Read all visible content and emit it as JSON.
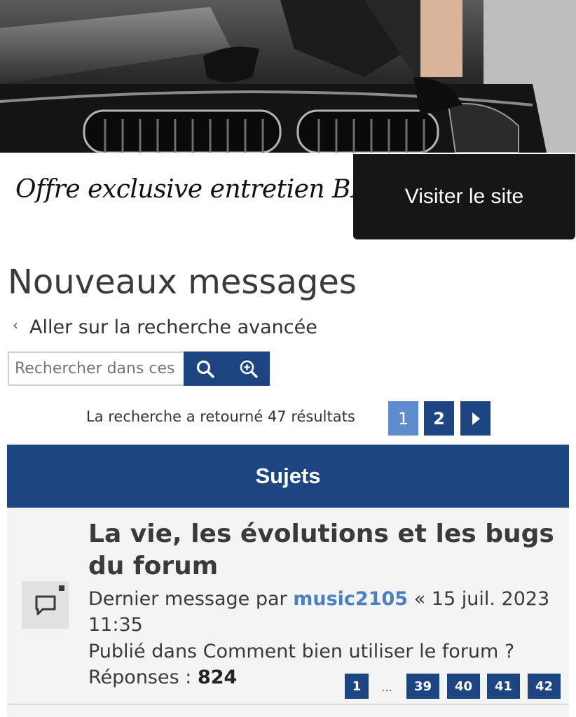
{
  "ad": {
    "banner_alt": "Mécanicien inspectant le moteur d'une BMW",
    "tagline": "Offre exclusive entretien BMW",
    "cta_label": "Visiter le site"
  },
  "page": {
    "title": "Nouveaux messages",
    "back_link": "Aller sur la recherche avancée"
  },
  "search": {
    "placeholder": "Rechercher dans ces résultats…",
    "value": "",
    "search_icon": "search-icon",
    "advanced_icon": "zoom-plus-icon"
  },
  "pagination": {
    "summary": "La recherche a retourné 47 résultats",
    "pages": [
      "1",
      "2"
    ],
    "current": "1",
    "next_icon": "triangle-right-icon"
  },
  "topics": {
    "header": "Sujets",
    "items": [
      {
        "title": "La vie, les évolutions et les bugs du forum",
        "last_post_prefix": "Dernier message par",
        "author": "music2105",
        "date": "« 15 juil. 2023 11:35",
        "posted_in": "Publié dans Comment bien utiliser le forum ?",
        "replies_label": "Réponses :",
        "replies": "824",
        "pages": [
          "1",
          "…",
          "39",
          "40",
          "41",
          "42"
        ],
        "icon": "chat-bubble-icon"
      }
    ]
  },
  "colors": {
    "primary": "#1d4582",
    "active_page": "#5f8ccc",
    "author_link": "#4a7fc1",
    "row_bg": "#f4f4f4"
  }
}
